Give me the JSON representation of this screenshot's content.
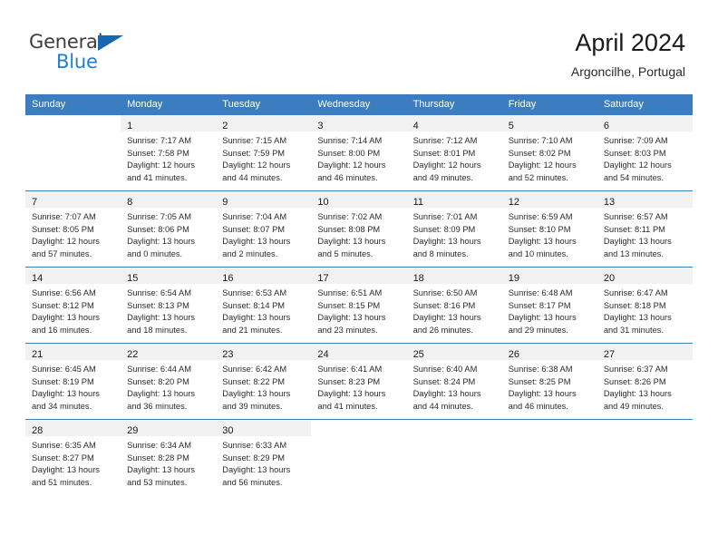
{
  "brand": {
    "name_top": "General",
    "name_bottom": "Blue",
    "accent_color": "#1668b3",
    "blue_text_color": "#1f7fd0"
  },
  "header": {
    "title": "April 2024",
    "location": "Argoncilhe, Portugal"
  },
  "calendar": {
    "header_bg": "#3b7dc0",
    "header_text_color": "#ffffff",
    "daynum_band_bg": "#f1f1f1",
    "weekday_headers": [
      "Sunday",
      "Monday",
      "Tuesday",
      "Wednesday",
      "Thursday",
      "Friday",
      "Saturday"
    ],
    "weeks": [
      [
        {
          "day": "",
          "lines": []
        },
        {
          "day": "1",
          "lines": [
            "Sunrise: 7:17 AM",
            "Sunset: 7:58 PM",
            "Daylight: 12 hours",
            "and 41 minutes."
          ]
        },
        {
          "day": "2",
          "lines": [
            "Sunrise: 7:15 AM",
            "Sunset: 7:59 PM",
            "Daylight: 12 hours",
            "and 44 minutes."
          ]
        },
        {
          "day": "3",
          "lines": [
            "Sunrise: 7:14 AM",
            "Sunset: 8:00 PM",
            "Daylight: 12 hours",
            "and 46 minutes."
          ]
        },
        {
          "day": "4",
          "lines": [
            "Sunrise: 7:12 AM",
            "Sunset: 8:01 PM",
            "Daylight: 12 hours",
            "and 49 minutes."
          ]
        },
        {
          "day": "5",
          "lines": [
            "Sunrise: 7:10 AM",
            "Sunset: 8:02 PM",
            "Daylight: 12 hours",
            "and 52 minutes."
          ]
        },
        {
          "day": "6",
          "lines": [
            "Sunrise: 7:09 AM",
            "Sunset: 8:03 PM",
            "Daylight: 12 hours",
            "and 54 minutes."
          ]
        }
      ],
      [
        {
          "day": "7",
          "lines": [
            "Sunrise: 7:07 AM",
            "Sunset: 8:05 PM",
            "Daylight: 12 hours",
            "and 57 minutes."
          ]
        },
        {
          "day": "8",
          "lines": [
            "Sunrise: 7:05 AM",
            "Sunset: 8:06 PM",
            "Daylight: 13 hours",
            "and 0 minutes."
          ]
        },
        {
          "day": "9",
          "lines": [
            "Sunrise: 7:04 AM",
            "Sunset: 8:07 PM",
            "Daylight: 13 hours",
            "and 2 minutes."
          ]
        },
        {
          "day": "10",
          "lines": [
            "Sunrise: 7:02 AM",
            "Sunset: 8:08 PM",
            "Daylight: 13 hours",
            "and 5 minutes."
          ]
        },
        {
          "day": "11",
          "lines": [
            "Sunrise: 7:01 AM",
            "Sunset: 8:09 PM",
            "Daylight: 13 hours",
            "and 8 minutes."
          ]
        },
        {
          "day": "12",
          "lines": [
            "Sunrise: 6:59 AM",
            "Sunset: 8:10 PM",
            "Daylight: 13 hours",
            "and 10 minutes."
          ]
        },
        {
          "day": "13",
          "lines": [
            "Sunrise: 6:57 AM",
            "Sunset: 8:11 PM",
            "Daylight: 13 hours",
            "and 13 minutes."
          ]
        }
      ],
      [
        {
          "day": "14",
          "lines": [
            "Sunrise: 6:56 AM",
            "Sunset: 8:12 PM",
            "Daylight: 13 hours",
            "and 16 minutes."
          ]
        },
        {
          "day": "15",
          "lines": [
            "Sunrise: 6:54 AM",
            "Sunset: 8:13 PM",
            "Daylight: 13 hours",
            "and 18 minutes."
          ]
        },
        {
          "day": "16",
          "lines": [
            "Sunrise: 6:53 AM",
            "Sunset: 8:14 PM",
            "Daylight: 13 hours",
            "and 21 minutes."
          ]
        },
        {
          "day": "17",
          "lines": [
            "Sunrise: 6:51 AM",
            "Sunset: 8:15 PM",
            "Daylight: 13 hours",
            "and 23 minutes."
          ]
        },
        {
          "day": "18",
          "lines": [
            "Sunrise: 6:50 AM",
            "Sunset: 8:16 PM",
            "Daylight: 13 hours",
            "and 26 minutes."
          ]
        },
        {
          "day": "19",
          "lines": [
            "Sunrise: 6:48 AM",
            "Sunset: 8:17 PM",
            "Daylight: 13 hours",
            "and 29 minutes."
          ]
        },
        {
          "day": "20",
          "lines": [
            "Sunrise: 6:47 AM",
            "Sunset: 8:18 PM",
            "Daylight: 13 hours",
            "and 31 minutes."
          ]
        }
      ],
      [
        {
          "day": "21",
          "lines": [
            "Sunrise: 6:45 AM",
            "Sunset: 8:19 PM",
            "Daylight: 13 hours",
            "and 34 minutes."
          ]
        },
        {
          "day": "22",
          "lines": [
            "Sunrise: 6:44 AM",
            "Sunset: 8:20 PM",
            "Daylight: 13 hours",
            "and 36 minutes."
          ]
        },
        {
          "day": "23",
          "lines": [
            "Sunrise: 6:42 AM",
            "Sunset: 8:22 PM",
            "Daylight: 13 hours",
            "and 39 minutes."
          ]
        },
        {
          "day": "24",
          "lines": [
            "Sunrise: 6:41 AM",
            "Sunset: 8:23 PM",
            "Daylight: 13 hours",
            "and 41 minutes."
          ]
        },
        {
          "day": "25",
          "lines": [
            "Sunrise: 6:40 AM",
            "Sunset: 8:24 PM",
            "Daylight: 13 hours",
            "and 44 minutes."
          ]
        },
        {
          "day": "26",
          "lines": [
            "Sunrise: 6:38 AM",
            "Sunset: 8:25 PM",
            "Daylight: 13 hours",
            "and 46 minutes."
          ]
        },
        {
          "day": "27",
          "lines": [
            "Sunrise: 6:37 AM",
            "Sunset: 8:26 PM",
            "Daylight: 13 hours",
            "and 49 minutes."
          ]
        }
      ],
      [
        {
          "day": "28",
          "lines": [
            "Sunrise: 6:35 AM",
            "Sunset: 8:27 PM",
            "Daylight: 13 hours",
            "and 51 minutes."
          ]
        },
        {
          "day": "29",
          "lines": [
            "Sunrise: 6:34 AM",
            "Sunset: 8:28 PM",
            "Daylight: 13 hours",
            "and 53 minutes."
          ]
        },
        {
          "day": "30",
          "lines": [
            "Sunrise: 6:33 AM",
            "Sunset: 8:29 PM",
            "Daylight: 13 hours",
            "and 56 minutes."
          ]
        },
        {
          "day": "",
          "lines": []
        },
        {
          "day": "",
          "lines": []
        },
        {
          "day": "",
          "lines": []
        },
        {
          "day": "",
          "lines": []
        }
      ]
    ]
  }
}
